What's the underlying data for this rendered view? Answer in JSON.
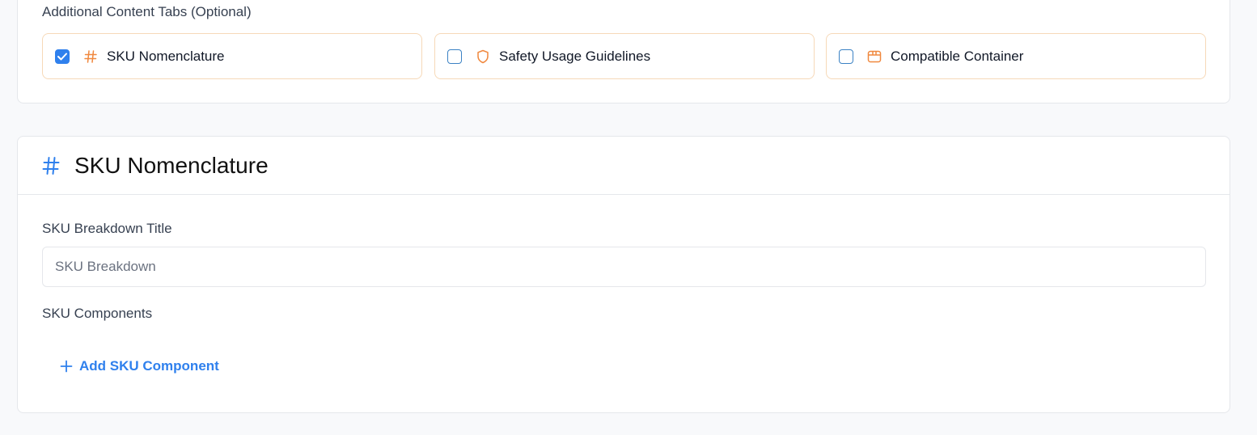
{
  "colors": {
    "accent": "#2f80ed",
    "orange": "#f0883e",
    "tab_border": "#f6d9b8"
  },
  "tabs_section": {
    "label": "Additional Content Tabs (Optional)",
    "options": [
      {
        "label": "SKU Nomenclature",
        "checked": true,
        "icon": "hash-icon"
      },
      {
        "label": "Safety Usage Guidelines",
        "checked": false,
        "icon": "shield-icon"
      },
      {
        "label": "Compatible Container",
        "checked": false,
        "icon": "box-icon"
      }
    ]
  },
  "sku_section": {
    "title": "SKU Nomenclature",
    "icon": "hash-icon",
    "breakdown_title_label": "SKU Breakdown Title",
    "breakdown_title_placeholder": "SKU Breakdown",
    "components_label": "SKU Components",
    "add_component_label": "Add SKU Component"
  }
}
